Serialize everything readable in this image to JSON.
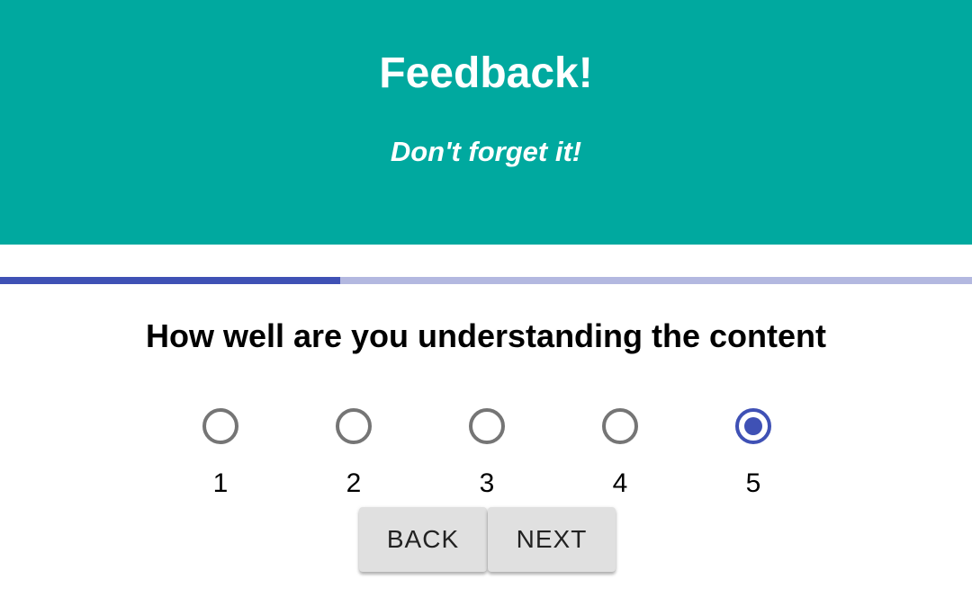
{
  "header": {
    "title": "Feedback!",
    "subtitle": "Don't forget it!",
    "background_color": "#00a99f"
  },
  "progress": {
    "fraction": 0.35,
    "fill_color": "#3f51b5",
    "track_color": "#b3b8e0"
  },
  "question": {
    "text": "How well are you understanding the content"
  },
  "scale": {
    "selected": "5",
    "options": [
      {
        "label": "1",
        "checked": false
      },
      {
        "label": "2",
        "checked": false
      },
      {
        "label": "3",
        "checked": false
      },
      {
        "label": "4",
        "checked": false
      },
      {
        "label": "5",
        "checked": true
      }
    ],
    "accent_color": "#3f51b5"
  },
  "buttons": {
    "back_label": "BACK",
    "next_label": "NEXT"
  }
}
